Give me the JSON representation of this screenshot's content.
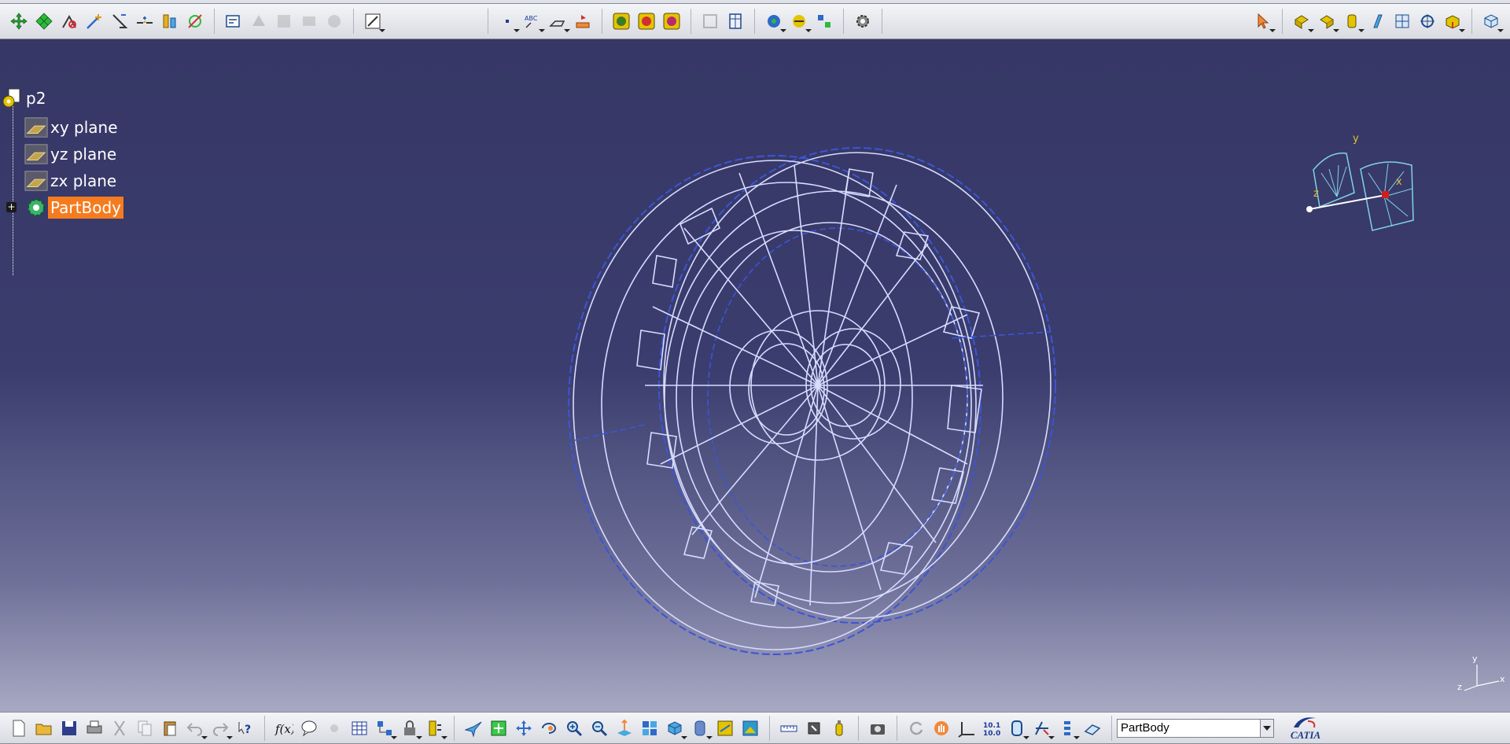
{
  "tree": {
    "root": "p2",
    "items": [
      {
        "label": "xy plane",
        "icon": "plane-icon"
      },
      {
        "label": "yz plane",
        "icon": "plane-icon"
      },
      {
        "label": "zx plane",
        "icon": "plane-icon"
      }
    ],
    "body": "PartBody"
  },
  "compass": {
    "x_label": "x",
    "y_label": "y",
    "z_label": "z"
  },
  "axis_triad": {
    "x_label": "x",
    "y_label": "y",
    "z_label": "z"
  },
  "current_body_combo": "PartBody",
  "logo_text": "CATIA",
  "colors": {
    "background_top": "#353664",
    "background_bottom": "#b6b7cc",
    "wire": "#d8dcff",
    "wire_dashed": "#3b55d6",
    "selection": "#f47c1f"
  },
  "top_toolbar_icons": [
    "translate-icon",
    "rotate-icon",
    "symmetry-icon",
    "point-icon",
    "line-icon",
    "plane-icon",
    "projection-icon",
    "intersection-icon",
    "sketch-analysis-icon",
    "constraint-icon",
    "constraint-dim-icon",
    "fix-together-icon",
    "auto-constraint-icon",
    "sketch-icon",
    "point-small-icon",
    "text-icon",
    "annotation-icon",
    "flag-icon",
    "publish-icon",
    "render-icon",
    "material-icon",
    "table-icon",
    "grid-icon",
    "catalog-icon",
    "knowledge-icon",
    "rules-icon",
    "settings-icon",
    "select-icon",
    "pad-icon",
    "pocket-icon",
    "shaft-icon",
    "groove-icon",
    "hole-icon",
    "rib-icon",
    "box-icon",
    "cube-icon"
  ],
  "bottom_toolbar_icons": [
    "new-icon",
    "open-icon",
    "save-icon",
    "print-icon",
    "cut-icon",
    "copy-icon",
    "paste-icon",
    "undo-icon",
    "redo-icon",
    "help-icon",
    "formula-icon",
    "comment-icon",
    "parameter-icon",
    "table-icon",
    "knowledge-icon",
    "lock-icon",
    "hybrid-icon",
    "fly-icon",
    "fit-all-icon",
    "pan-icon",
    "rotate-view-icon",
    "zoom-in-icon",
    "zoom-out-icon",
    "normal-view-icon",
    "multi-view-icon",
    "iso-view-icon",
    "hide-show-icon",
    "swap-icon",
    "image-icon",
    "measure-icon",
    "inertia-icon",
    "scan-icon",
    "capture-icon",
    "update-icon",
    "hand-icon",
    "axis-icon",
    "number-icon",
    "space-icon",
    "sketcher-icon",
    "list-icon",
    "body-icon"
  ]
}
